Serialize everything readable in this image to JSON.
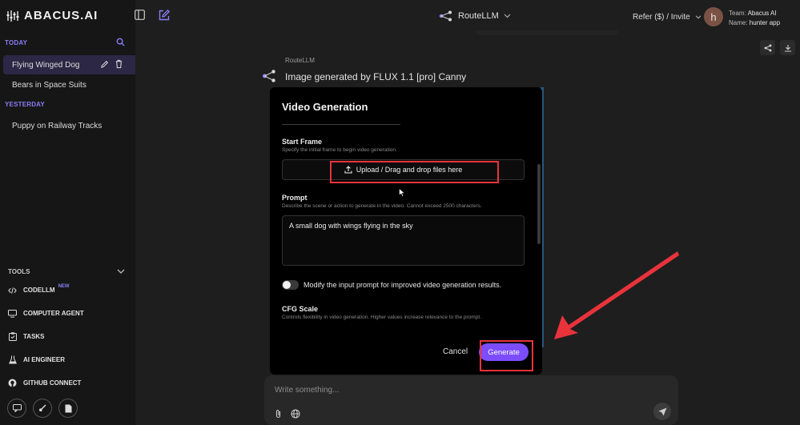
{
  "app": {
    "logo_text": "ABACUS.AI"
  },
  "sidebar": {
    "sections": [
      {
        "label": "TODAY",
        "items": [
          {
            "label": "Flying Winged Dog",
            "active": true
          },
          {
            "label": "Bears in Space Suits"
          }
        ]
      },
      {
        "label": "YESTERDAY",
        "items": [
          {
            "label": "Puppy on Railway Tracks"
          }
        ]
      }
    ],
    "tools_label": "TOOLS",
    "tools": [
      {
        "label": "CODELLM",
        "badge": "NEW",
        "icon": "code-icon"
      },
      {
        "label": "COMPUTER AGENT",
        "icon": "monitor-icon"
      },
      {
        "label": "TASKS",
        "icon": "clipboard-icon"
      },
      {
        "label": "AI ENGINEER",
        "icon": "flask-icon"
      },
      {
        "label": "GITHUB CONNECT",
        "icon": "github-icon"
      }
    ]
  },
  "header": {
    "model": "RouteLLM",
    "refer": "Refer ($) / Invite",
    "avatar_initial": "h",
    "team_label": "Team:",
    "team_value": "Abacus AI",
    "name_label": "Name:",
    "name_value": "hunter app"
  },
  "chat": {
    "sender": "RouteLLM",
    "message": "Image generated by FLUX 1.1 [pro] Canny"
  },
  "modal": {
    "title": "Video Generation",
    "start_frame_label": "Start Frame",
    "start_frame_desc": "Specify the initial frame to begin video generation.",
    "upload_label": "Upload / Drag and drop files here",
    "prompt_label": "Prompt",
    "prompt_desc": "Describe the scene or action to generate in the video. Cannot exceed 2500 characters.",
    "prompt_value": "A small dog with wings flying in the sky",
    "toggle_label": "Modify the input prompt for improved video generation results.",
    "toggle_on": false,
    "cfg_label": "CFG Scale",
    "cfg_desc": "Controls flexibility in video generation. Higher values increase relevance to the prompt.",
    "cancel_label": "Cancel",
    "generate_label": "Generate"
  },
  "composer": {
    "placeholder": "Write something..."
  },
  "colors": {
    "accent": "#7c4dff",
    "highlight": "#e8333b",
    "section_label": "#8b7cf6"
  }
}
